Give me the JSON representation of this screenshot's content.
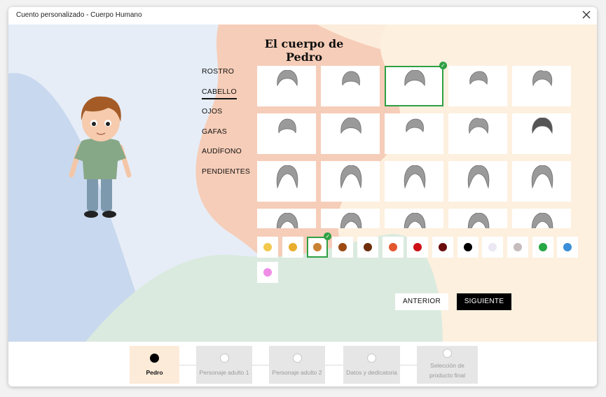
{
  "window": {
    "title": "Cuento personalizado - Cuerpo Humano",
    "close_icon": "close-icon"
  },
  "main": {
    "heading": "El cuerpo de Pedro",
    "menu": [
      {
        "label": "ROSTRO",
        "active": false
      },
      {
        "label": "CABELLO",
        "active": true
      },
      {
        "label": "OJOS",
        "active": false
      },
      {
        "label": "GAFAS",
        "active": false
      },
      {
        "label": "AUDÍFONO",
        "active": false
      },
      {
        "label": "PENDIENTES",
        "active": false
      }
    ],
    "hair_styles": {
      "count_visible": 20,
      "selected_index": 2
    },
    "colors": [
      {
        "hex": "#f2c94c",
        "selected": false
      },
      {
        "hex": "#e9ad2c",
        "selected": false
      },
      {
        "hex": "#c98132",
        "selected": true
      },
      {
        "hex": "#9c4a12",
        "selected": false
      },
      {
        "hex": "#6e2e0b",
        "selected": false
      },
      {
        "hex": "#e4572e",
        "selected": false
      },
      {
        "hex": "#cc1016",
        "selected": false
      },
      {
        "hex": "#6b0b0b",
        "selected": false
      },
      {
        "hex": "#000000",
        "selected": false
      },
      {
        "hex": "#ebe8f3",
        "selected": false
      },
      {
        "hex": "#c6bcbc",
        "selected": false
      },
      {
        "hex": "#27a745",
        "selected": false
      },
      {
        "hex": "#3a8fd8",
        "selected": false
      },
      {
        "hex": "#ef8de6",
        "selected": false
      }
    ],
    "buttons": {
      "prev": "ANTERIOR",
      "next": "SIGUIENTE"
    }
  },
  "stepper": {
    "steps": [
      {
        "label": "Pedro",
        "active": true
      },
      {
        "label": "Personaje adulto 1",
        "active": false
      },
      {
        "label": "Personaje adulto 2",
        "active": false
      },
      {
        "label": "Datos y dedicatoria",
        "active": false
      },
      {
        "label": "Selección de producto final",
        "active": false
      }
    ]
  },
  "theme": {
    "accent_selected": "#2ea043",
    "bg_blue": "#e6edf7",
    "bg_peach": "#f6cdb8",
    "bg_cream": "#fdf0df",
    "bg_green": "#dbeadf"
  }
}
